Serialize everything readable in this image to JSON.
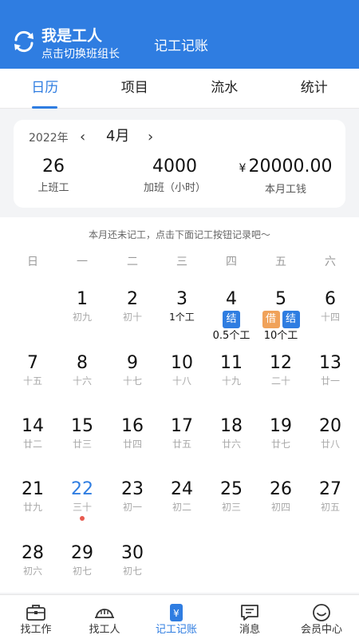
{
  "header": {
    "role_title": "我是工人",
    "role_subtitle": "点击切换班组长",
    "title": "记工记账",
    "bg_color": "#2f7de1"
  },
  "tabs": [
    {
      "label": "日历",
      "active": true
    },
    {
      "label": "项目",
      "active": false
    },
    {
      "label": "流水",
      "active": false
    },
    {
      "label": "统计",
      "active": false
    }
  ],
  "summary": {
    "year": "2022年",
    "prev": "‹",
    "month": "4月",
    "next": "›",
    "work_days": {
      "value": "26",
      "label": "上班工"
    },
    "overtime": {
      "value": "4000",
      "label": "加班（小时）"
    },
    "wage": {
      "currency": "¥",
      "value": "20000.00",
      "label": "本月工钱"
    }
  },
  "calendar": {
    "tip": "本月还未记工，点击下面记工按钮记录吧～",
    "weekdays": [
      "日",
      "一",
      "二",
      "三",
      "四",
      "五",
      "六"
    ],
    "days": [
      {
        "d": "1",
        "l": "初九"
      },
      {
        "d": "2",
        "l": "初十"
      },
      {
        "d": "3",
        "w": "1个工"
      },
      {
        "d": "4",
        "badges": [
          "结"
        ],
        "amt": "0.5个工"
      },
      {
        "d": "5",
        "badges": [
          "借",
          "结"
        ],
        "amt": "10个工"
      },
      {
        "d": "6",
        "l": "十四"
      },
      {
        "d": "7",
        "l": "十五"
      },
      {
        "d": "8",
        "l": "十六"
      },
      {
        "d": "9",
        "l": "十七"
      },
      {
        "d": "10",
        "l": "十八"
      },
      {
        "d": "11",
        "l": "十九"
      },
      {
        "d": "12",
        "l": "二十"
      },
      {
        "d": "13",
        "l": "廿一"
      },
      {
        "d": "14",
        "l": "廿二"
      },
      {
        "d": "15",
        "l": "廿三"
      },
      {
        "d": "16",
        "l": "廿四"
      },
      {
        "d": "17",
        "l": "廿五"
      },
      {
        "d": "18",
        "l": "廿六"
      },
      {
        "d": "19",
        "l": "廿七"
      },
      {
        "d": "20",
        "l": "廿八"
      },
      {
        "d": "21",
        "l": "廿九"
      },
      {
        "d": "22",
        "l": "三十",
        "today": true
      },
      {
        "d": "23",
        "l": "初一"
      },
      {
        "d": "24",
        "l": "初二"
      },
      {
        "d": "25",
        "l": "初三"
      },
      {
        "d": "26",
        "l": "初四"
      },
      {
        "d": "27",
        "l": "初五"
      },
      {
        "d": "28",
        "l": "初六"
      },
      {
        "d": "29",
        "l": "初七"
      },
      {
        "d": "30",
        "l": "初七"
      }
    ],
    "badge_colors": {
      "结": "#2f7de1",
      "借": "#f0a25a"
    },
    "today_color": "#2f7de1",
    "today_dot_color": "#e85a4f"
  },
  "bottom_nav": [
    {
      "label": "找工作",
      "icon": "briefcase-icon",
      "active": false
    },
    {
      "label": "找工人",
      "icon": "helmet-icon",
      "active": false
    },
    {
      "label": "记工记账",
      "icon": "ledger-icon",
      "active": true
    },
    {
      "label": "消息",
      "icon": "message-icon",
      "active": false
    },
    {
      "label": "会员中心",
      "icon": "member-icon",
      "active": false
    }
  ]
}
